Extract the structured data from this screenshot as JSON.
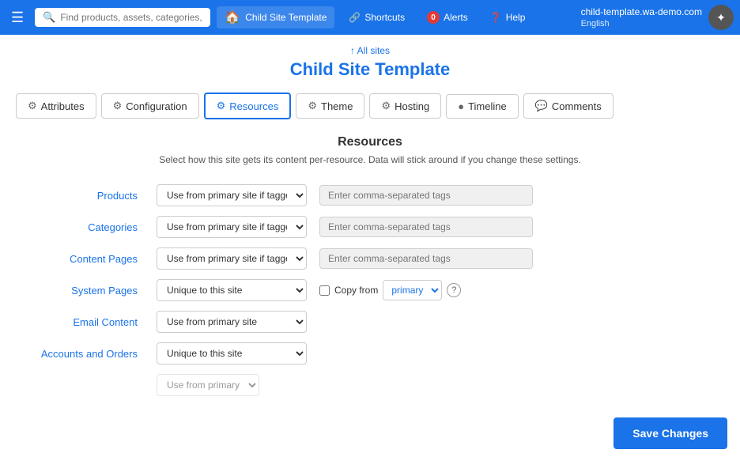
{
  "topnav": {
    "hamburger_icon": "☰",
    "search_placeholder": "Find products, assets, categories, orders, e",
    "site_badge_icon": "🏠",
    "site_badge_label": "Child Site Template",
    "shortcuts_icon": "🔗",
    "shortcuts_label": "Shortcuts",
    "alerts_count": "0",
    "alerts_label": "Alerts",
    "help_icon": "?",
    "help_label": "Help",
    "domain": "child-template.wa-demo.com",
    "language": "English"
  },
  "page_header": {
    "all_sites_label": "↑ All sites",
    "title": "Child Site Template"
  },
  "tabs": [
    {
      "id": "attributes",
      "label": "Attributes",
      "icon": "⚙",
      "active": false
    },
    {
      "id": "configuration",
      "label": "Configuration",
      "icon": "⚙",
      "active": false
    },
    {
      "id": "resources",
      "label": "Resources",
      "icon": "⚙",
      "active": true
    },
    {
      "id": "theme",
      "label": "Theme",
      "icon": "⚙",
      "active": false
    },
    {
      "id": "hosting",
      "label": "Hosting",
      "icon": "⚙",
      "active": false
    },
    {
      "id": "timeline",
      "label": "Timeline",
      "icon": "●",
      "active": false
    },
    {
      "id": "comments",
      "label": "Comments",
      "icon": "💬",
      "active": false
    }
  ],
  "resources_section": {
    "title": "Resources",
    "subtitle": "Select how this site gets its content per-resource. Data will stick around if you change these settings.",
    "rows": [
      {
        "id": "products",
        "label": "Products",
        "select_value": "Use from primary site if tagged",
        "tags_placeholder": "Enter comma-separated tags",
        "show_tags": true,
        "show_copy": false
      },
      {
        "id": "categories",
        "label": "Categories",
        "select_value": "Use from primary site if tagged",
        "tags_placeholder": "Enter comma-separated tags",
        "show_tags": true,
        "show_copy": false
      },
      {
        "id": "content_pages",
        "label": "Content Pages",
        "select_value": "Use from primary site if tagged",
        "tags_placeholder": "Enter comma-separated tags",
        "show_tags": true,
        "show_copy": false
      },
      {
        "id": "system_pages",
        "label": "System Pages",
        "select_value": "Unique to this site",
        "show_tags": false,
        "show_copy": true,
        "copy_label": "Copy from",
        "copy_select_value": "primary"
      },
      {
        "id": "email_content",
        "label": "Email Content",
        "select_value": "Use from primary site",
        "show_tags": false,
        "show_copy": false
      },
      {
        "id": "accounts_orders",
        "label": "Accounts and Orders",
        "select_value": "Unique to this site",
        "show_tags": false,
        "show_copy": false
      },
      {
        "id": "more_row",
        "label": "",
        "select_value": "Use from primary site",
        "show_tags": false,
        "show_copy": false,
        "partial": true
      }
    ],
    "select_options": [
      "Use from primary site if tagged",
      "Use from primary site",
      "Unique to this site"
    ]
  },
  "footer": {
    "save_label": "Save Changes"
  }
}
